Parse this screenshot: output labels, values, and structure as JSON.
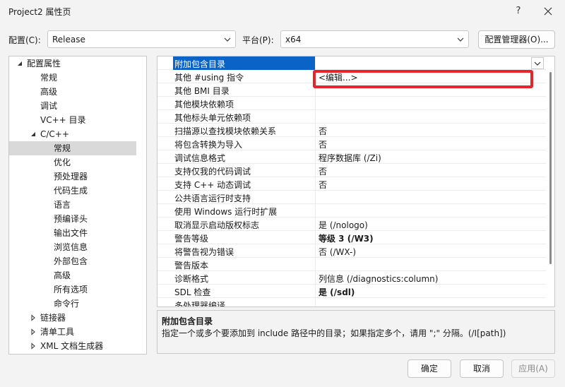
{
  "window": {
    "title": "Project2 属性页",
    "help_label": "?"
  },
  "toolbar": {
    "config_label": "配置(C):",
    "config_value": "Release",
    "platform_label": "平台(P):",
    "platform_value": "x64",
    "config_manager_label": "配置管理器(O)..."
  },
  "tree": {
    "items": [
      {
        "label": "配置属性",
        "state": "expanded"
      },
      {
        "label": "常规"
      },
      {
        "label": "高级"
      },
      {
        "label": "调试"
      },
      {
        "label": "VC++ 目录"
      },
      {
        "label": "C/C++",
        "state": "expanded"
      },
      {
        "label": "常规",
        "selected": true
      },
      {
        "label": "优化"
      },
      {
        "label": "预处理器"
      },
      {
        "label": "代码生成"
      },
      {
        "label": "语言"
      },
      {
        "label": "预编译头"
      },
      {
        "label": "输出文件"
      },
      {
        "label": "浏览信息"
      },
      {
        "label": "外部包含"
      },
      {
        "label": "高级"
      },
      {
        "label": "所有选项"
      },
      {
        "label": "命令行"
      },
      {
        "label": "链接器",
        "state": "collapsed"
      },
      {
        "label": "清单工具",
        "state": "collapsed"
      },
      {
        "label": "XML 文档生成器",
        "state": "collapsed"
      }
    ]
  },
  "grid": {
    "rows": [
      {
        "name": "附加包含目录",
        "value": "",
        "selected": true
      },
      {
        "name": "其他 #using 指令",
        "value": "<编辑...>"
      },
      {
        "name": "其他 BMI 目录",
        "value": ""
      },
      {
        "name": "其他模块依赖项",
        "value": ""
      },
      {
        "name": "其他标头单元依赖项",
        "value": ""
      },
      {
        "name": "扫描源以查找模块依赖关系",
        "value": "否"
      },
      {
        "name": "将包含转换为导入",
        "value": "否"
      },
      {
        "name": "调试信息格式",
        "value": "程序数据库 (/Zi)"
      },
      {
        "name": "支持仅我的代码调试",
        "value": "否"
      },
      {
        "name": "支持 C++ 动态调试",
        "value": "否"
      },
      {
        "name": "公共语言运行时支持",
        "value": ""
      },
      {
        "name": "使用 Windows 运行时扩展",
        "value": ""
      },
      {
        "name": "取消显示启动版权标志",
        "value": "是 (/nologo)"
      },
      {
        "name": "警告等级",
        "value": "等级 3 (/W3)",
        "bold": true
      },
      {
        "name": "将警告视为错误",
        "value": "否 (/WX-)"
      },
      {
        "name": "警告版本",
        "value": ""
      },
      {
        "name": "诊断格式",
        "value": "列信息 (/diagnostics:column)"
      },
      {
        "name": "SDL 检查",
        "value": "是 (/sdl)",
        "bold": true
      },
      {
        "name": "多处理器编译",
        "value": ""
      }
    ]
  },
  "description": {
    "title": "附加包含目录",
    "text": "指定一个或多个要添加到 include 路径中的目录；如果指定多个，请用 \";\" 分隔。(/I[path])"
  },
  "buttons": {
    "ok": "确定",
    "cancel": "取消",
    "apply": "应用(A)"
  },
  "colors": {
    "selection": "#0a64c8",
    "highlight_box": "#e8242b",
    "tree_selection": "#d9d9d9"
  }
}
